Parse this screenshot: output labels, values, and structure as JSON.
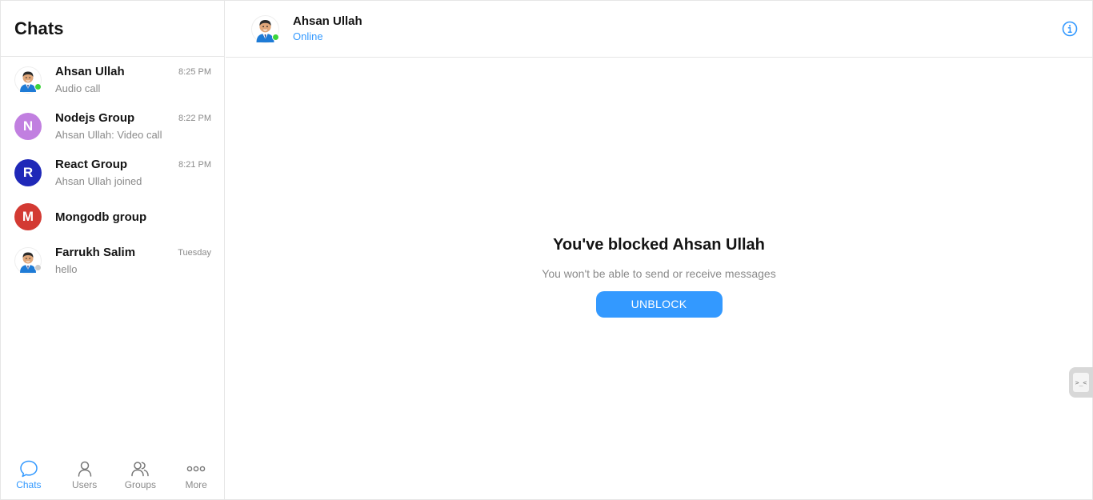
{
  "sidebar": {
    "title": "Chats",
    "chats": [
      {
        "name": "Ahsan Ullah",
        "subtitle": "Audio call",
        "time": "8:25 PM",
        "avatar": "person",
        "presence": "online"
      },
      {
        "name": "Nodejs Group",
        "subtitle": "Ahsan Ullah: Video call",
        "time": "8:22 PM",
        "avatar": "N",
        "color": "#c17fe0"
      },
      {
        "name": "React Group",
        "subtitle": "Ahsan Ullah joined",
        "time": "8:21 PM",
        "avatar": "R",
        "color": "#1f28b8"
      },
      {
        "name": "Mongodb group",
        "subtitle": "",
        "time": "",
        "avatar": "M",
        "color": "#d33a33"
      },
      {
        "name": "Farrukh Salim",
        "subtitle": "hello",
        "time": "Tuesday",
        "avatar": "person",
        "presence": "offline"
      }
    ],
    "nav": [
      {
        "label": "Chats",
        "icon": "chat-bubble-icon",
        "active": true
      },
      {
        "label": "Users",
        "icon": "user-icon",
        "active": false
      },
      {
        "label": "Groups",
        "icon": "users-icon",
        "active": false
      },
      {
        "label": "More",
        "icon": "more-icon",
        "active": false
      }
    ]
  },
  "header": {
    "name": "Ahsan Ullah",
    "status": "Online",
    "info_icon": "info-icon"
  },
  "blocked": {
    "title": "You've blocked Ahsan Ullah",
    "subtitle": "You won't be able to send or receive messages",
    "button": "UNBLOCK"
  },
  "colors": {
    "accent": "#3399ff",
    "online": "#3bd43b"
  }
}
